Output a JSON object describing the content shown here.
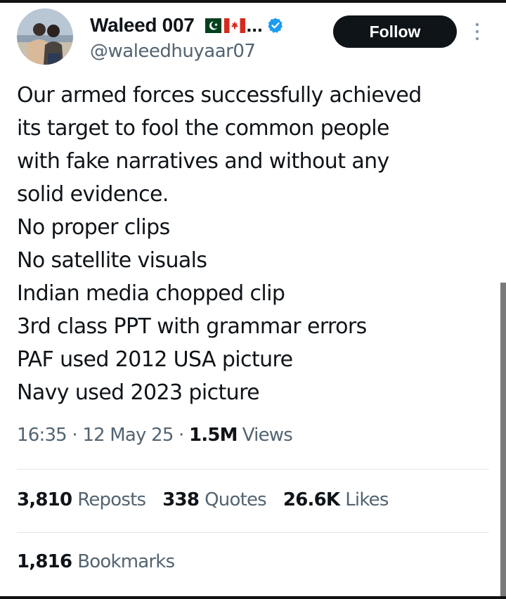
{
  "author": {
    "display_name": "Waleed 007",
    "name_truncation": "...",
    "handle": "@waleedhuyaar07",
    "verified": true,
    "avatar_icon": "avatar-couple-photo",
    "flags": [
      "pakistan-flag",
      "canada-flag"
    ]
  },
  "header": {
    "follow_label": "Follow",
    "more_icon": "more-vertical-icon"
  },
  "tweet": {
    "lines": [
      "Our armed forces successfully achieved",
      "its target to fool the common people",
      "with fake narratives and without any",
      "solid evidence.",
      "No proper clips",
      "No satellite visuals",
      "Indian media chopped clip",
      "3rd class PPT with grammar errors",
      "PAF used 2012 USA picture",
      "Navy used 2023 picture"
    ]
  },
  "meta": {
    "time": "16:35",
    "separator": " · ",
    "date": "12 May 25",
    "views_count": "1.5M",
    "views_label": "Views"
  },
  "stats": {
    "reposts_count": "3,810",
    "reposts_label": "Reposts",
    "quotes_count": "338",
    "quotes_label": "Quotes",
    "likes_count": "26.6K",
    "likes_label": "Likes",
    "bookmarks_count": "1,816",
    "bookmarks_label": "Bookmarks"
  },
  "colors": {
    "text_primary": "#0f1419",
    "text_secondary": "#536471",
    "verified_blue": "#1d9bf0",
    "button_bg": "#0f1419",
    "divider": "#e1e6ea"
  }
}
